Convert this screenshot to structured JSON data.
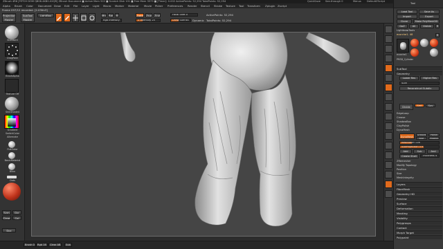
{
  "app": {
    "title": "ZBrush 4R6 [FETCH DOM QB08-4KB0-0XQR] ZBrush Document  ■ Active Mem 522 ■ Scratch Disk 101 ■ Free Mem 3573 ■ [Timer]: 0.002 ActivePoints: 52,294 TotalPoints: 52,294",
    "quicksave": "QuickSave",
    "see_through": "See-through 0",
    "menus_label": "Menus",
    "default_script": "DefaultZScript"
  },
  "menubar": {
    "items": [
      "Alpha",
      "Brush",
      "Color",
      "Document",
      "Draw",
      "Edit",
      "File",
      "Layer",
      "Light",
      "Macro",
      "Marker",
      "Material",
      "Movie",
      "Picker",
      "Preferences",
      "Render",
      "Stencil",
      "Stroke",
      "Texture",
      "Tool",
      "Transform",
      "Zplugin",
      "Zscript"
    ]
  },
  "toolbar": {
    "projection_master": "Projection\nMaster",
    "lightbox": "LightBox",
    "subtool_master": "SubTool\nMaster",
    "edit_label": "Edit",
    "draw_label": "Draw",
    "move_label": "Move",
    "scale_label": "Scale",
    "rotate_label": "Rotate",
    "mrgb": "Mrgb",
    "rgb": "Rgb",
    "m": "M",
    "zadd": "Zadd",
    "zsub": "Zsub",
    "zcut": "Zcut",
    "rgb_intensity": "Rgb Intensity",
    "z_intensity": "Z Intensity 25",
    "focal_shift": "Focal Shift 0",
    "draw_size": "Draw Size 64",
    "dynamic": "Dynamic",
    "active_points": "ActivePoints: 52,294",
    "total_points": "TotalPoints: 52,294",
    "frame_status": "Frame 097/12 recorded. [2.03fm3]"
  },
  "left_shelf": {
    "brush_label": "Standard",
    "stroke_label": "DragRect",
    "alpha_label": "BrushAlpha",
    "texture_label": "Texture Off",
    "material_label": "SkinShade4",
    "gradient_label": "Gradient",
    "switch_color": "SwitchColor",
    "alternate": "Alternate",
    "material_swatches": [
      "FlatColor",
      "BasicMaterial",
      "Blinn"
    ],
    "dots_label": "Dots",
    "small_btns": [
      "Sym",
      "Gyr",
      "Clear",
      "Col"
    ],
    "doc_label": "Doc"
  },
  "bottombar": {
    "items": [
      "Brush 0",
      "Rgb 16",
      "Clear AB",
      "Sub"
    ]
  },
  "right_shelf": {
    "icons": [
      "bpr-icon",
      "spix-icon",
      "scroll-icon",
      "zoom-icon",
      "actual-icon",
      "aahalf-icon",
      "persp-icon",
      "floor-icon",
      "local-icon",
      "xyz-icon",
      "frame-icon",
      "move-icon",
      "scale-icon",
      "rotate-icon",
      "polyf-icon",
      "transp-icon",
      "solo-icon",
      "xpose-icon"
    ]
  },
  "tray": {
    "header": "Tool",
    "load_tool": "Load Tool",
    "save_as": "Save As",
    "import": "Import",
    "export": "Export",
    "clone": "Clone",
    "make_polymesh3d": "Make PolyMesh3D",
    "goz": "GoZ",
    "all": "All",
    "visible": "Visible",
    "r": "R",
    "lightbox_tools": "Lightbox▸Tools",
    "current_tool": "ecorche1. 48",
    "r_btn": "R",
    "thumbnails": [
      "ecorche1",
      "SphereBrush",
      "AlphaBrush",
      "SimpleBrush",
      "ecorche",
      "PM3D_Cylinder"
    ],
    "subtool": "SubTool",
    "geometry": "Geometry",
    "lower_res": "Lower Res",
    "higher_res": "Higher Res",
    "sdiv": "SDiv",
    "reconstruct_subdiv": "Reconstruct Subdiv",
    "divide": "Divide",
    "smt": "Smt",
    "suv": "Suv",
    "edge_loop": "EdgeLoop",
    "crease": "Crease",
    "shadowbox": "ShadowBox",
    "claypolish": "ClayPolish",
    "dynamesh": "DynaMesh",
    "dynamesh_btn": "DynaMesh",
    "groups": "Groups",
    "polish": "Polish",
    "blur": "Blur",
    "project": "Project",
    "resolution": "Resolution 128",
    "sub_projection": "SubProjection 0.6",
    "add": "Add",
    "sub": "Sub",
    "and": "And",
    "create_shell": "Create Shell",
    "thickness": "Thickness 4",
    "zremesher": "ZRemesher",
    "modify_topology": "Modify Topology",
    "position": "Position",
    "size": "Size",
    "meshintegrity": "MeshIntegrity",
    "sections": [
      "Layers",
      "FiberMesh",
      "Geometry HD",
      "Preview",
      "Surface",
      "Deformation",
      "Masking",
      "Visibility",
      "Polygroups",
      "Contact",
      "Morph Target",
      "Polypaint"
    ]
  },
  "colors": {
    "accent": "#e06a1c",
    "canvas": "#454545",
    "panel": "#3a3a3a",
    "dark": "#262626"
  }
}
